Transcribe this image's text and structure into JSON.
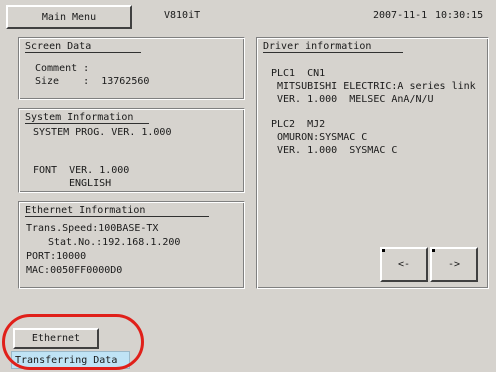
{
  "header": {
    "main_menu_label": "Main Menu",
    "model": "V810iT",
    "date": "2007-11-1",
    "time": "10:30:15"
  },
  "screen_data": {
    "title": "Screen Data",
    "comment": "Comment :",
    "size": "Size    :  13762560"
  },
  "system_info": {
    "title": "System Information",
    "prog": "SYSTEM PROG. VER. 1.000",
    "font": "FONT  VER. 1.000",
    "font_lang": "ENGLISH"
  },
  "ethernet_info": {
    "title": "Ethernet Information",
    "speed": "Trans.Speed:100BASE-TX",
    "station": "Stat.No.:192.168.1.200",
    "port": "PORT:10000",
    "mac": "MAC:0050FF0000D0"
  },
  "driver_info": {
    "title": "Driver information",
    "plc1_header": "PLC1  CN1",
    "plc1_maker": "MITSUBISHI ELECTRIC:A series link",
    "plc1_ver": "VER. 1.000  MELSEC AnA/N/U",
    "plc2_header": "PLC2  MJ2",
    "plc2_maker": "OMURON:SYSMAC C",
    "plc2_ver": "VER. 1.000  SYSMAC C"
  },
  "nav": {
    "prev_label": "<-",
    "next_label": "->"
  },
  "ethernet_button": {
    "label": "Ethernet",
    "status": "Transferring Data"
  },
  "colors": {
    "background": "#d6d3ce",
    "status_bg": "#bfe3f5",
    "highlight_ring": "#e0201a"
  }
}
